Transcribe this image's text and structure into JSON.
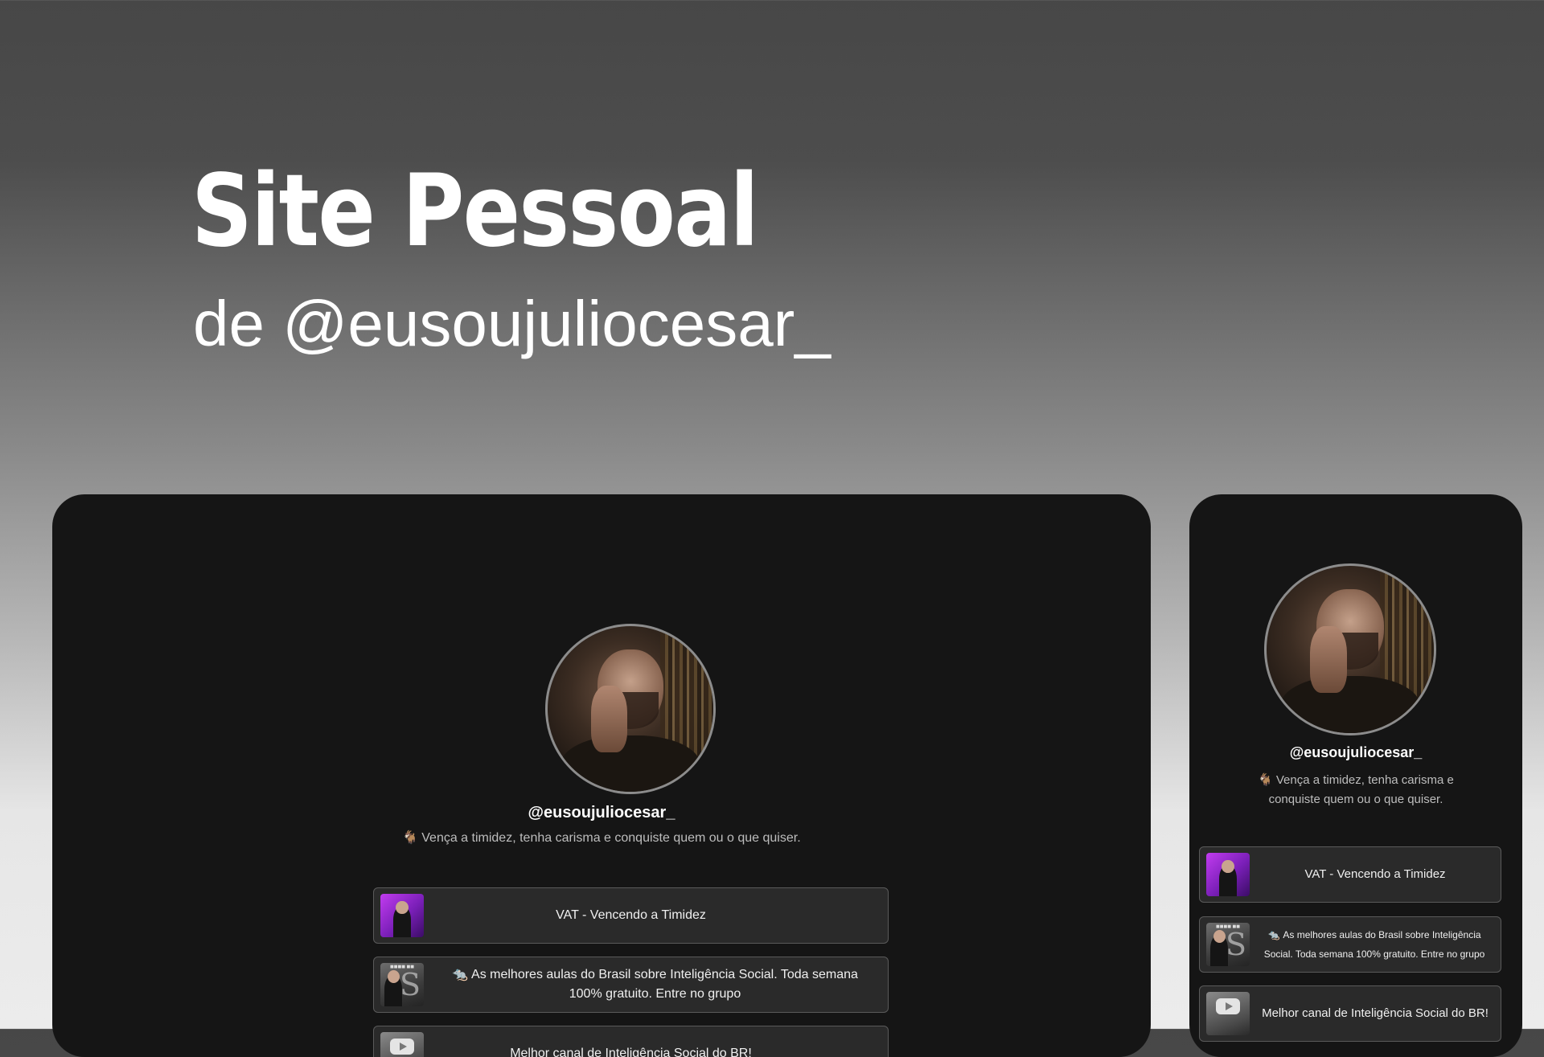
{
  "hero": {
    "title": "Site Pessoal",
    "subtitle": "de @eusoujuliocesar_"
  },
  "profile": {
    "username": "@eusoujuliocesar_",
    "bio_icon": "🐐",
    "bio": "Vença a timidez, tenha carisma e conquiste quem ou o que quiser.",
    "bio_mobile_line1": "Vença a timidez, tenha carisma e",
    "bio_mobile_line2": "conquiste quem ou o que quiser."
  },
  "links": [
    {
      "label": "VAT - Vencendo a Timidez",
      "thumb_icon": "vat-course-thumbnail"
    },
    {
      "emoji": "🐀",
      "label": "As melhores aulas do Brasil sobre Inteligência Social. Toda semana 100% gratuito. Entre no grupo",
      "label_line1": "As melhores aulas do Brasil sobre Inteligência Social. Toda semana",
      "label_line2": "100% gratuito. Entre no grupo",
      "mobile_line1": "As melhores aulas do Brasil sobre Inteligência",
      "mobile_line2": "Social. Toda semana 100% gratuito. Entre no grupo",
      "thumb_icon": "group-thumbnail"
    },
    {
      "label": "Melhor canal de Inteligência Social do BR!",
      "thumb_icon": "youtube-thumbnail"
    }
  ],
  "colors": {
    "device_bg": "#151515",
    "card_bg": "#2a2a2a",
    "card_border": "#5a5a5a",
    "text": "#ffffff",
    "muted_text": "#bdbdbd"
  }
}
